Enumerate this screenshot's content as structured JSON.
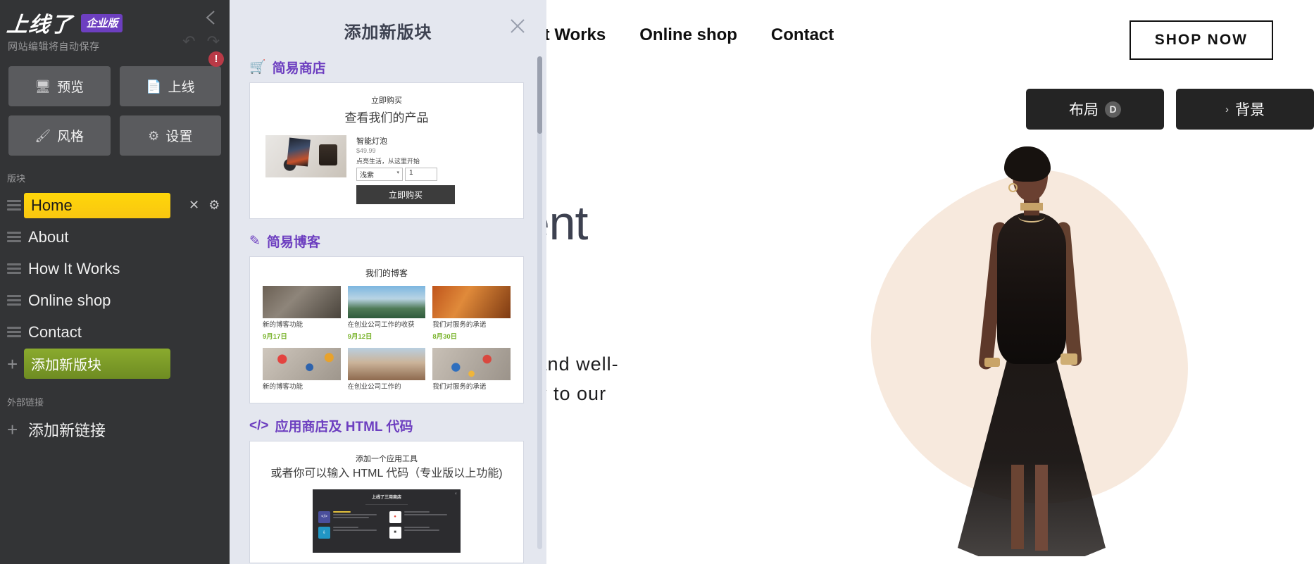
{
  "editor": {
    "brand": "上线了",
    "brand_badge": "企业版",
    "autosave_note": "网站编辑将自动保存",
    "collapse_icon": "chevron-left-icon",
    "undo_icon": "undo-arrow-icon",
    "redo_icon": "redo-arrow-icon",
    "alert_badge": "!",
    "tools": [
      {
        "label": "预览",
        "icon": "monitor-icon"
      },
      {
        "label": "上线",
        "icon": "document-icon"
      },
      {
        "label": "风格",
        "icon": "paintbrush-icon"
      },
      {
        "label": "设置",
        "icon": "gear-icon"
      }
    ],
    "pages_label": "版块",
    "pages": [
      {
        "label": "Home",
        "active": true,
        "has_actions": true
      },
      {
        "label": "About",
        "active": false,
        "has_actions": false
      },
      {
        "label": "How It Works",
        "active": false,
        "has_actions": false
      },
      {
        "label": "Online shop",
        "active": false,
        "has_actions": false
      },
      {
        "label": "Contact",
        "active": false,
        "has_actions": false
      }
    ],
    "add_page_label": "添加新版块",
    "external_links_label": "外部链接",
    "add_link_label": "添加新链接",
    "row_action_delete": "✕",
    "row_action_settings": "⚙"
  },
  "modal": {
    "title": "添加新版块",
    "close_icon": "close-icon",
    "categories": [
      {
        "name": "简易商店",
        "icon": "shopping-cart-icon",
        "preview": {
          "kind": "shop",
          "eyebrow": "立即购买",
          "heading": "查看我们的产品",
          "product_name": "智能灯泡",
          "product_price": "$49.99",
          "product_desc": "点亮生活，从这里开始",
          "variant_value": "浅紫",
          "quantity_value": "1",
          "buy_label": "立即购买"
        }
      },
      {
        "name": "简易博客",
        "icon": "pen-icon",
        "preview": {
          "kind": "blog",
          "heading": "我们的博客",
          "posts": [
            {
              "title": "新的博客功能",
              "date": "9月17日"
            },
            {
              "title": "在创业公司工作的收获",
              "date": "9月12日"
            },
            {
              "title": "我们对服务的承诺",
              "date": "8月30日"
            },
            {
              "title": "新的博客功能",
              "date": ""
            },
            {
              "title": "在创业公司工作的",
              "date": ""
            },
            {
              "title": "我们对服务的承诺",
              "date": ""
            }
          ]
        }
      },
      {
        "name": "应用商店及 HTML 代码",
        "icon": "code-icon",
        "preview": {
          "kind": "html",
          "eyebrow": "添加一个应用工具",
          "heading": "或者你可以输入 HTML 代码（专业版以上功能)",
          "shot_title": "上线了三用商店",
          "shot_items": [
            {
              "label": "HTML",
              "badge": "代码工具"
            },
            {
              "label": "百度地图"
            },
            {
              "label": "下载组件"
            },
            {
              "label": ""
            }
          ]
        }
      }
    ]
  },
  "site": {
    "nav_links": [
      "It Works",
      "Online shop",
      "Contact"
    ],
    "shop_now_label": "SHOP NOW",
    "hero_heading": "dent",
    "hero_paragraph_line1": "uality and well-",
    "hero_paragraph_line2": "directly to our"
  },
  "section_toolbar": [
    {
      "label": "布局",
      "kbd": "D",
      "chevron": ""
    },
    {
      "label": "背景",
      "kbd": "",
      "chevron": "›"
    }
  ],
  "colors": {
    "sidebar_bg": "#333436",
    "accent_yellow": "#ffd60a",
    "accent_green": "#7c9a28",
    "accent_purple": "#6d3fc0",
    "modal_bg": "#e4e7ef",
    "alert_red": "#b93a47",
    "blob_cream": "#f7e9dd"
  }
}
